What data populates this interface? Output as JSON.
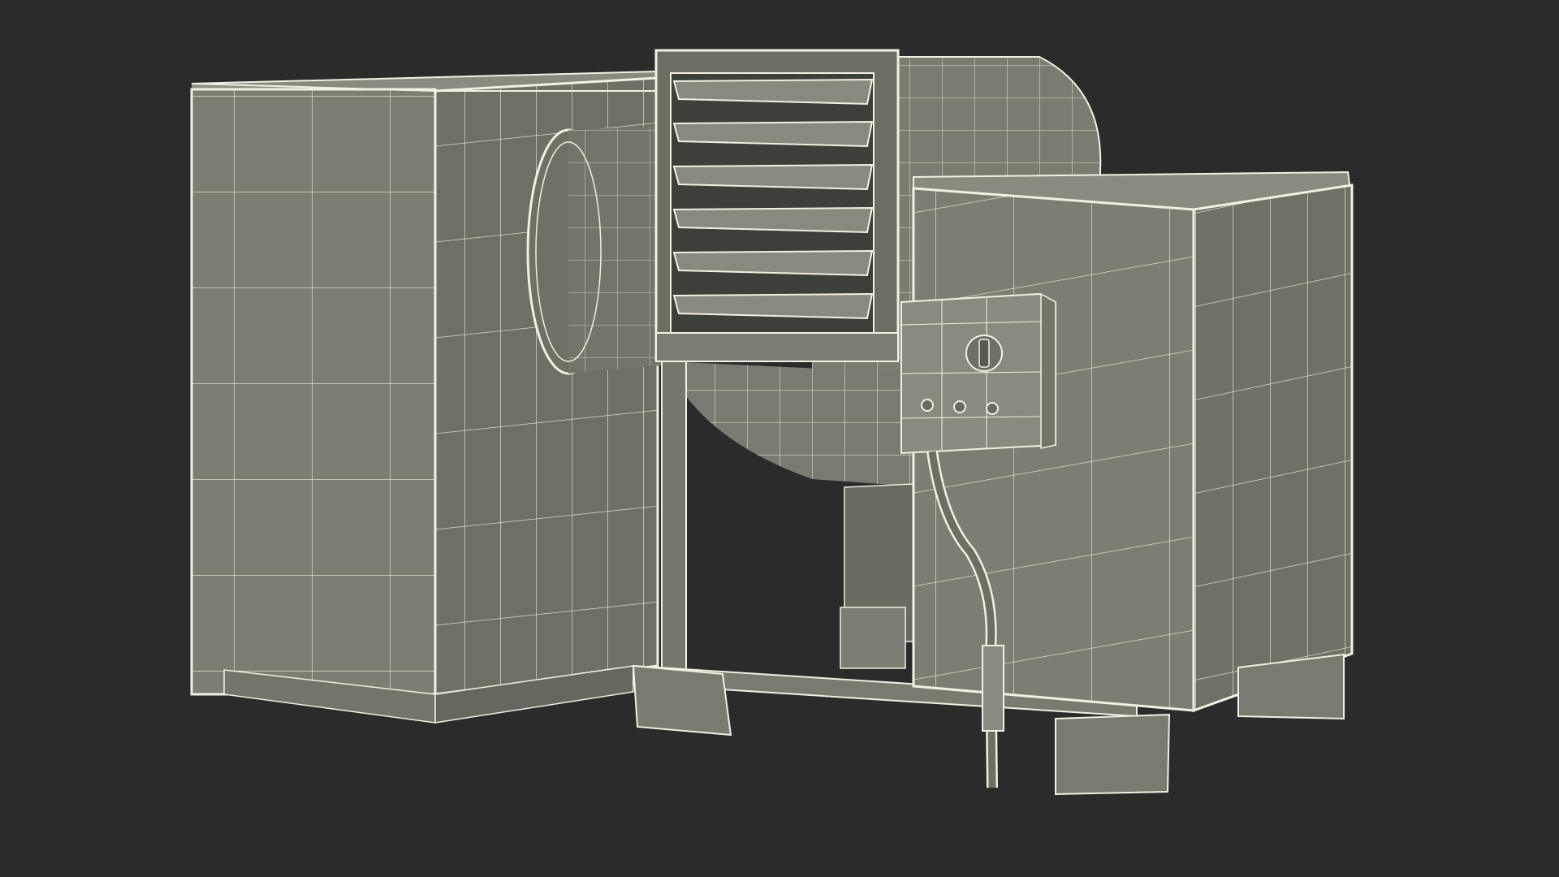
{
  "scene": {
    "background_color": "#2b2b2b",
    "surface_color": "#7e7e74",
    "wire_color": "#f2f0e4",
    "objects": [
      "left-condenser-box",
      "centrifugal-blower-housing",
      "circular-duct",
      "louvered-vent",
      "right-condenser-box",
      "control-box",
      "rotary-switch",
      "indicator-lamps",
      "flexible-conduit-cable",
      "base-frame",
      "support-feet"
    ]
  }
}
